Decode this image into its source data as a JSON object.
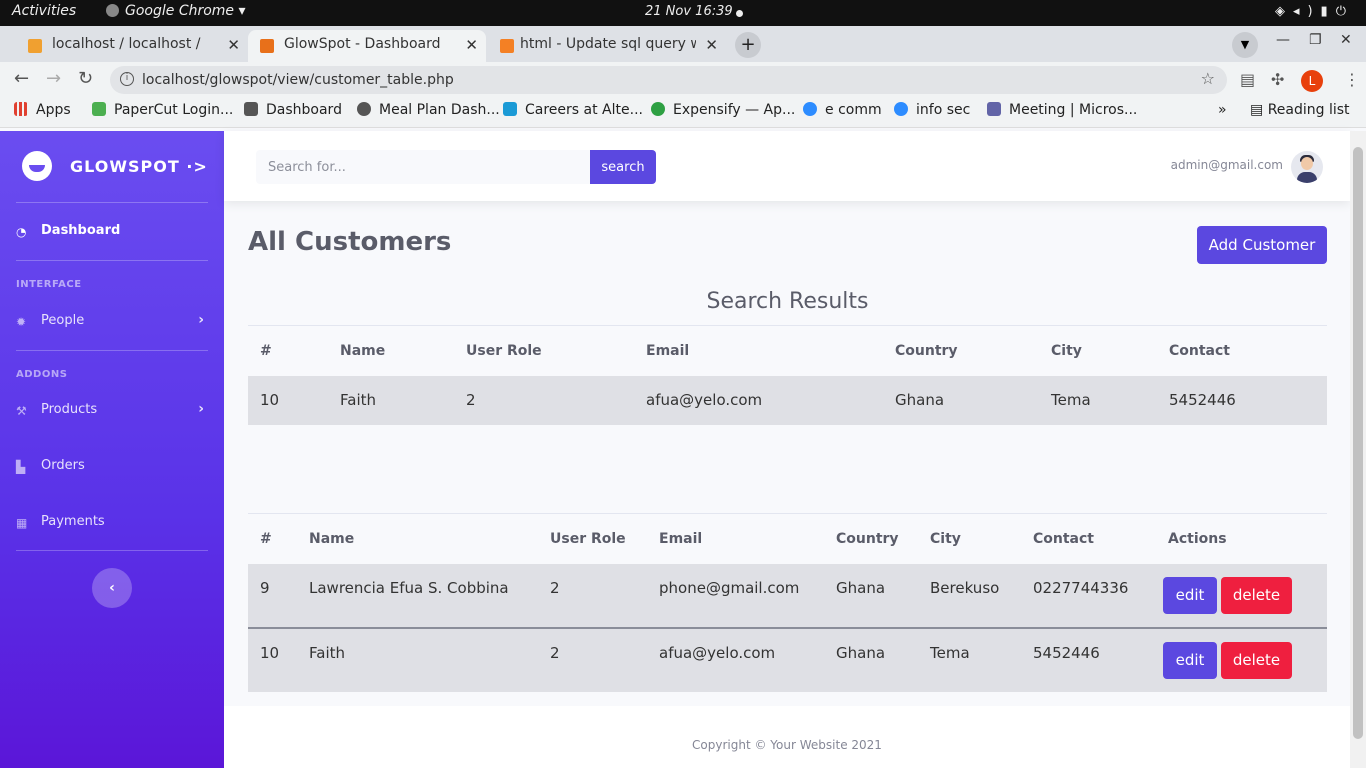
{
  "os": {
    "activities": "Activities",
    "app_name": "Google Chrome ▾",
    "clock": "21 Nov  16:39"
  },
  "browser": {
    "tabs": [
      {
        "title": "localhost / localhost / glo",
        "favicon_color": "#f0a030",
        "active": false
      },
      {
        "title": "GlowSpot - Dashboard",
        "favicon_color": "#e8701a",
        "active": true
      },
      {
        "title": "html - Update sql query w",
        "favicon_color": "#f48024",
        "active": false
      }
    ],
    "url": "localhost/glowspot/view/customer_table.php",
    "profile_initial": "L",
    "bookmarks": [
      {
        "label": "Apps",
        "icon_color": "#e04030"
      },
      {
        "label": "PaperCut Login...",
        "icon_color": "#4caf50"
      },
      {
        "label": "Dashboard",
        "icon_color": "#555555"
      },
      {
        "label": "Meal Plan Dash...",
        "icon_color": "#555555"
      },
      {
        "label": "Careers at Alte...",
        "icon_color": "#1a9ad6"
      },
      {
        "label": "Expensify — Ap...",
        "icon_color": "#2ea043"
      },
      {
        "label": "e comm",
        "icon_color": "#2d8cff"
      },
      {
        "label": "info sec",
        "icon_color": "#2d8cff"
      },
      {
        "label": "Meeting | Micros...",
        "icon_color": "#6264a7"
      }
    ],
    "reading_list": "Reading list"
  },
  "sidebar": {
    "brand": "GLOWSPOT ·>",
    "items": [
      {
        "label": "Dashboard",
        "icon": "tachometer-icon"
      },
      {
        "label": "People",
        "icon": "gear-icon"
      },
      {
        "label": "Products",
        "icon": "wrench-icon"
      },
      {
        "label": "Orders",
        "icon": "chart-area-icon"
      },
      {
        "label": "Payments",
        "icon": "table-icon"
      }
    ],
    "headings": {
      "interface": "INTERFACE",
      "addons": "ADDONS"
    },
    "toggle": "‹"
  },
  "topbar": {
    "search_placeholder": "Search for...",
    "search_button": "search",
    "user_email": "admin@gmail.com"
  },
  "main": {
    "title": "All Customers",
    "add_button": "Add Customer",
    "search_results_title": "Search Results",
    "results_headers": [
      "#",
      "Name",
      "User Role",
      "Email",
      "Country",
      "City",
      "Contact"
    ],
    "results_rows": [
      [
        "10",
        "Faith",
        "2",
        "afua@yelo.com",
        "Ghana",
        "Tema",
        "5452446"
      ]
    ],
    "table_headers": [
      "#",
      "Name",
      "User Role",
      "Email",
      "Country",
      "City",
      "Contact",
      "Actions"
    ],
    "table_rows": [
      [
        "9",
        "Lawrencia Efua S. Cobbina",
        "2",
        "phone@gmail.com",
        "Ghana",
        "Berekuso",
        "0227744336"
      ],
      [
        "10",
        "Faith",
        "2",
        "afua@yelo.com",
        "Ghana",
        "Tema",
        "5452446"
      ]
    ],
    "edit_label": "edit",
    "delete_label": "delete"
  },
  "footer": {
    "copyright": "Copyright © Your Website 2021"
  },
  "colors": {
    "primary": "#5b48e0",
    "danger": "#ef1f3f",
    "sidebar_top": "#6a4df0",
    "sidebar_bottom": "#5b16d8"
  }
}
